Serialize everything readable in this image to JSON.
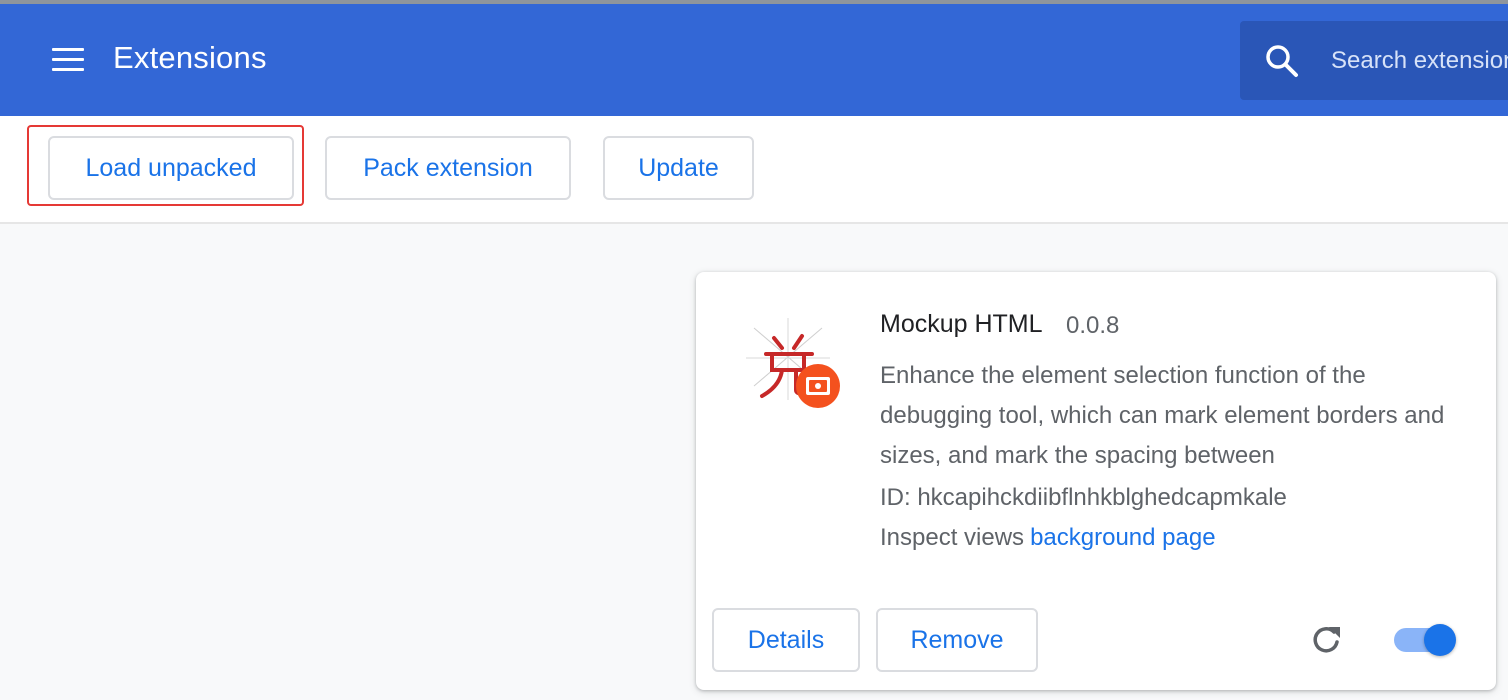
{
  "header": {
    "title": "Extensions",
    "menu_icon": "hamburger-menu-icon",
    "search": {
      "placeholder": "Search extensions",
      "value": "",
      "icon": "search-icon"
    },
    "background_color": "#3367d6"
  },
  "toolbar": {
    "load_unpacked_label": "Load unpacked",
    "pack_extension_label": "Pack extension",
    "update_label": "Update",
    "highlighted_button": "Load unpacked",
    "highlight_color": "#e53935"
  },
  "extension": {
    "name": "Mockup HTML",
    "version": "0.0.8",
    "description": "Enhance the element selection function of the debugging tool, which can mark element borders and sizes, and mark the spacing between",
    "id_label": "ID: hkcapihckdiibflnhkblghedcapmkale",
    "inspect_label": "Inspect views",
    "inspect_link": "background page",
    "details_label": "Details",
    "remove_label": "Remove",
    "reload_icon": "reload-icon",
    "enabled": true,
    "accent_color": "#1a73e8"
  }
}
